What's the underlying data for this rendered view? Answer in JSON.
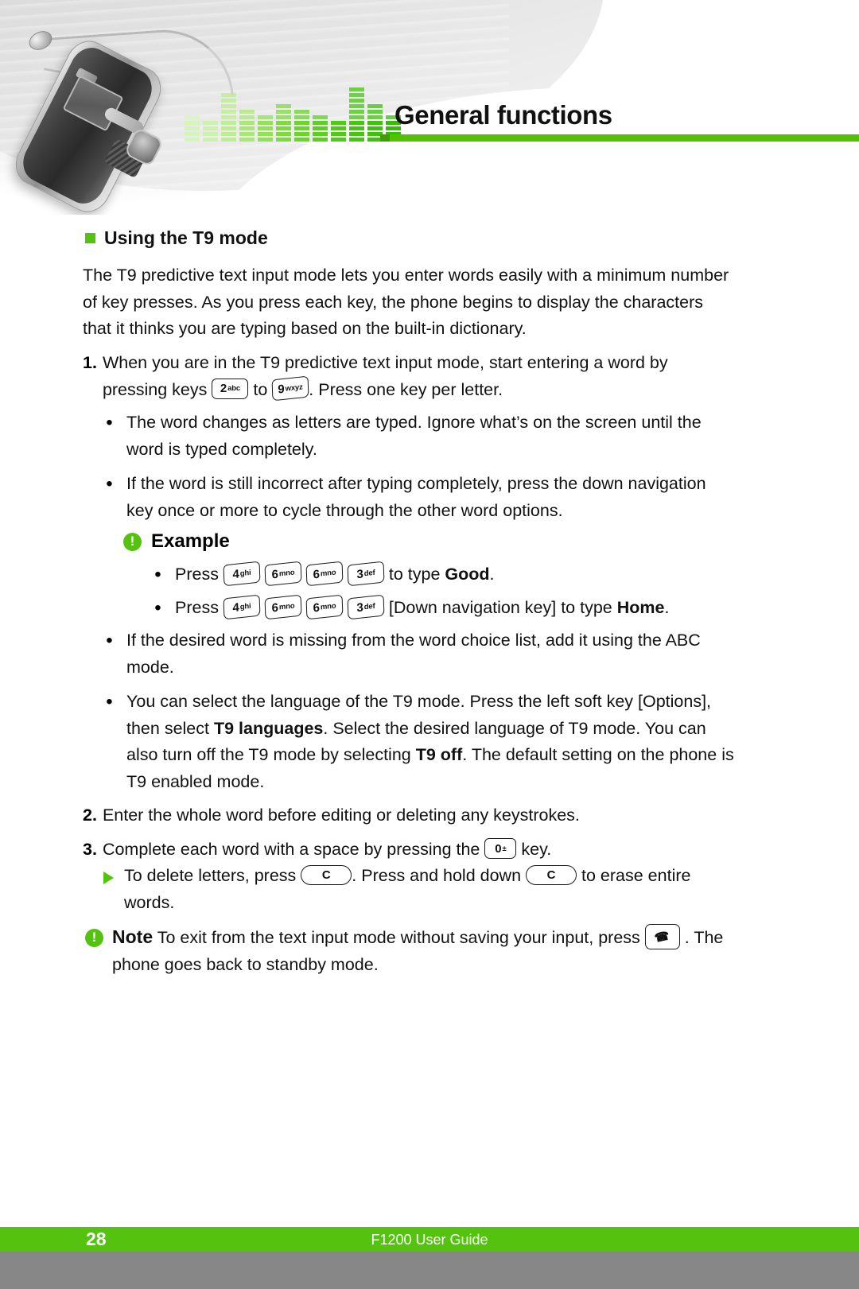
{
  "header": {
    "title": "General functions",
    "rule_color": "#54c000",
    "phone_image_alt": "LG flip phone with earphones",
    "equalizer": {
      "bars": [
        {
          "segments": 5,
          "color": "#d6f5bd"
        },
        {
          "segments": 4,
          "color": "#cdf2ae"
        },
        {
          "segments": 9,
          "color": "#bdee93"
        },
        {
          "segments": 6,
          "color": "#a9e873"
        },
        {
          "segments": 5,
          "color": "#93e155"
        },
        {
          "segments": 7,
          "color": "#7ddb3c"
        },
        {
          "segments": 6,
          "color": "#6ad62b"
        },
        {
          "segments": 5,
          "color": "#5bd11e"
        },
        {
          "segments": 4,
          "color": "#4ecc14"
        },
        {
          "segments": 10,
          "color": "#44c80d"
        },
        {
          "segments": 7,
          "color": "#3cc408"
        },
        {
          "segments": 5,
          "color": "#34bf04"
        }
      ]
    }
  },
  "section": {
    "bullet_color": "#55c210",
    "title": "Using the T9 mode",
    "intro": "The T9 predictive text input mode lets you enter words easily with a minimum number of key presses. As you press each key, the phone begins to display the characters that it thinks you are typing based on the built-in dictionary."
  },
  "steps": [
    {
      "number": "1.",
      "text_before": "When you are in the T9 predictive text input mode, start entering a word by pressing keys",
      "key_a": {
        "num": "2",
        "sub": "abc"
      },
      "text_middle": "to",
      "key_b": {
        "num": "9",
        "sub": "wxyz"
      },
      "text_after": ". Press one key per letter."
    },
    {
      "number": "2.",
      "text": "Enter the whole word before editing or deleting any keystrokes."
    },
    {
      "number": "3.",
      "text_before": "Complete each word with a space by pressing the",
      "key": {
        "num": "0",
        "sub": "±"
      },
      "text_after": "key."
    }
  ],
  "bullets": [
    {
      "text": "The word changes as letters are typed. Ignore what’s on the screen until the word is typed completely."
    },
    {
      "text": "If the word is still incorrect after typing completely, press the down navigation key once or more to cycle through the other word options."
    },
    {
      "text": "If the desired word is missing from the word choice list, add it using the ABC mode."
    }
  ],
  "language_bullet": {
    "part1": "You can select the language of the T9 mode. Press the left soft key [Options], then select ",
    "bold1": "T9 languages",
    "part2": ". Select the desired language of T9 mode. You can also turn off the T9 mode by selecting ",
    "bold2": "T9 off",
    "part3": ". The default setting on the phone is T9 enabled mode."
  },
  "example": {
    "icon": "exclamation-circle-icon",
    "heading": "Example",
    "lines": [
      {
        "press_label": "Press",
        "keys": [
          {
            "num": "4",
            "sub": "ghi"
          },
          {
            "num": "6",
            "sub": "mno"
          },
          {
            "num": "6",
            "sub": "mno"
          },
          {
            "num": "3",
            "sub": "def"
          }
        ],
        "tail_before": "to type ",
        "tail_bold": "Good",
        "tail_after": "."
      },
      {
        "press_label": "Press",
        "keys": [
          {
            "num": "4",
            "sub": "ghi"
          },
          {
            "num": "6",
            "sub": "mno"
          },
          {
            "num": "6",
            "sub": "mno"
          },
          {
            "num": "3",
            "sub": "def"
          }
        ],
        "tail_before": "[Down navigation key] to type ",
        "tail_bold": "Home",
        "tail_after": "."
      }
    ]
  },
  "delete_tip": {
    "text_before": "To delete letters, press",
    "key_c1": "C",
    "text_middle": ". Press and hold down",
    "key_c2": "C",
    "text_after": "to erase entire words."
  },
  "note": {
    "icon": "exclamation-circle-icon",
    "label": "Note",
    "text_before": "To exit from the text input mode without saving your input, press",
    "key_icon": "end-call-key-icon",
    "text_after": ". The phone goes back to standby mode."
  },
  "footer": {
    "page_number": "28",
    "guide_title": "F1200 User Guide",
    "bar_color": "#55c210",
    "under_color": "#878787"
  }
}
